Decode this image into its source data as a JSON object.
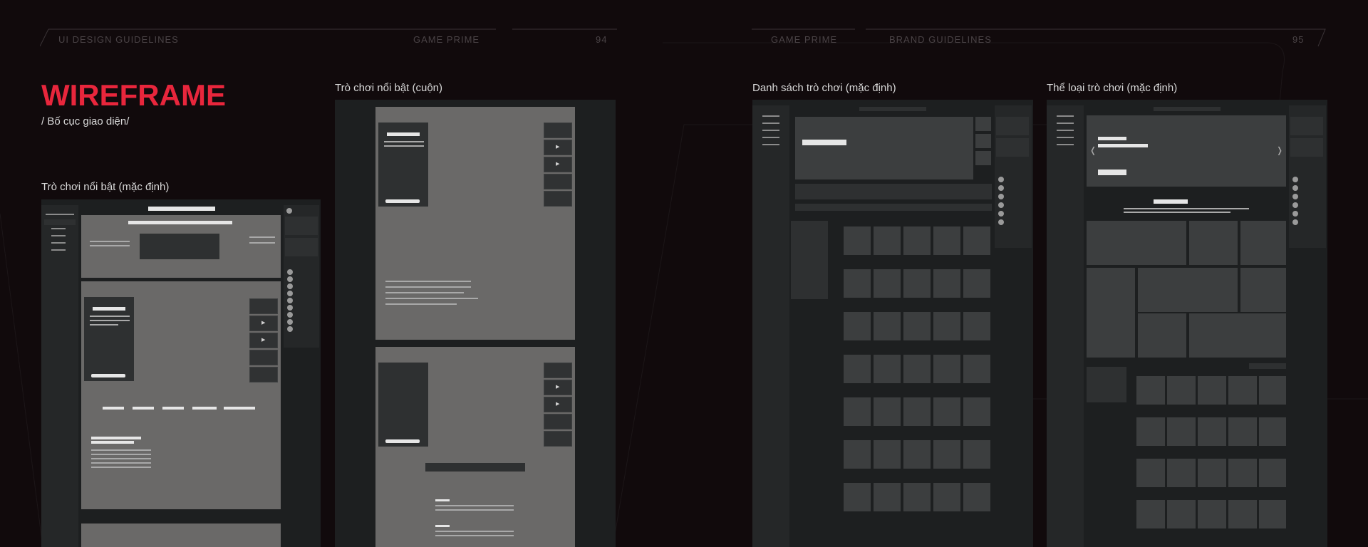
{
  "header": {
    "left": {
      "section": "UI DESIGN GUIDELINES",
      "brand": "GAME PRIME",
      "page": "94"
    },
    "right": {
      "brand": "GAME PRIME",
      "section": "BRAND GUIDELINES",
      "page": "95"
    }
  },
  "title": "WIREFRAME",
  "subtitle": "/ Bố cục giao diện/",
  "frames": {
    "featured_default": "Trò chơi nổi bật (mặc định)",
    "featured_scroll": "Trò chơi nổi bật (cuộn)",
    "game_list": "Danh sách trò chơi (mặc định)",
    "game_genre": "Thể loại trò chơi (mặc định)"
  },
  "colors": {
    "accent": "#e8263c",
    "background": "#110a0c",
    "wire_dark": "#1d1f20",
    "wire_gray": "#6a6968"
  },
  "icons": [
    "play-icon",
    "chevron-left-icon",
    "chevron-right-icon",
    "search-icon"
  ]
}
